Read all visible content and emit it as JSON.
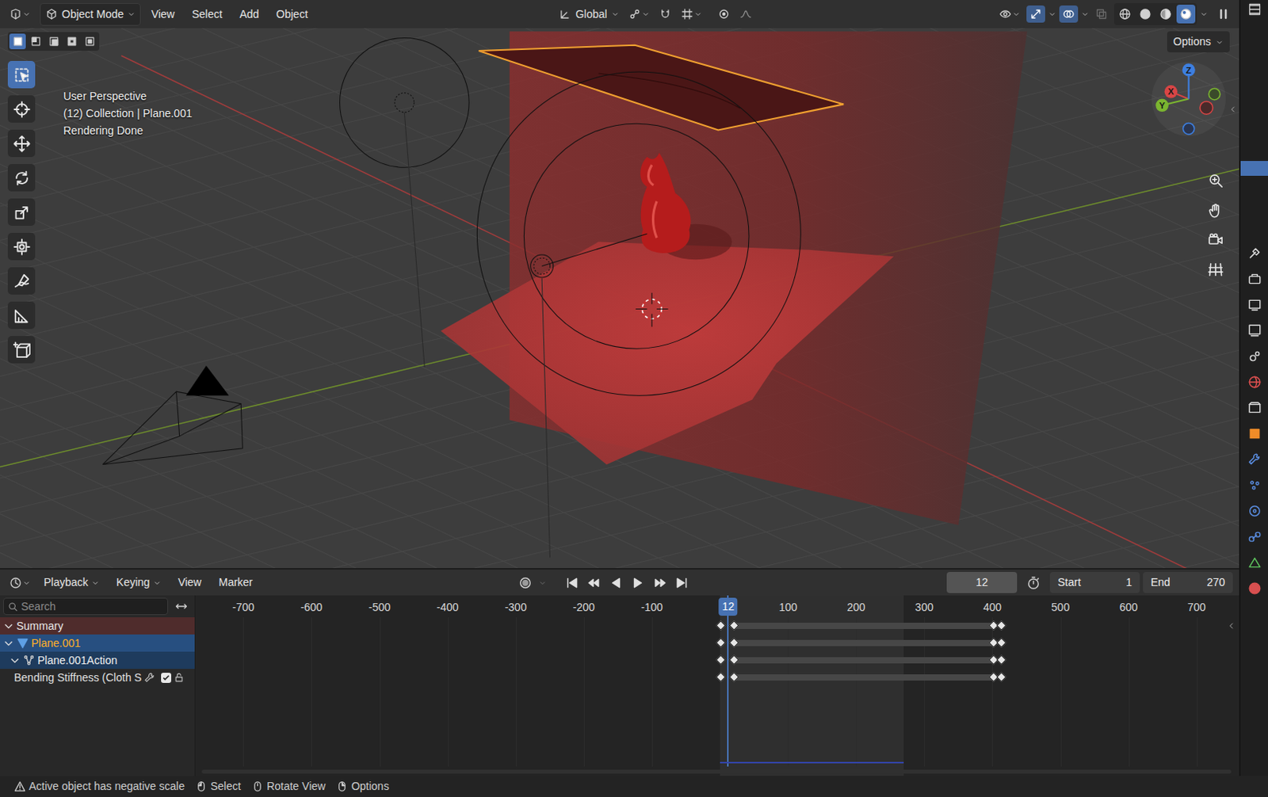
{
  "header": {
    "mode": "Object Mode",
    "menus": [
      "View",
      "Select",
      "Add",
      "Object"
    ],
    "orientation": "Global",
    "shading": [
      {
        "selected": false
      },
      {
        "selected": false
      },
      {
        "selected": false
      },
      {
        "selected": true
      }
    ]
  },
  "viewport": {
    "select_modes": [
      {
        "selected": true
      },
      {
        "selected": false
      },
      {
        "selected": false
      },
      {
        "selected": false
      },
      {
        "selected": false
      }
    ],
    "options": "Options",
    "tools": [
      {
        "selected": true
      },
      {
        "selected": false
      },
      {
        "selected": false
      },
      {
        "selected": false
      },
      {
        "selected": false
      },
      {
        "selected": false
      },
      {
        "selected": false
      },
      {
        "selected": false
      },
      {
        "selected": false
      }
    ],
    "overlay": [
      "User Perspective",
      "(12) Collection | Plane.001",
      "Rendering Done"
    ],
    "gizmo": [
      "X",
      "Y",
      "Z"
    ]
  },
  "outliner": {
    "rows": [
      {
        "selected": true
      }
    ]
  },
  "timeline": {
    "menus": [
      "Playback",
      "Keying",
      "View",
      "Marker"
    ],
    "auto_keying": false,
    "current_frame": "12",
    "start_label": "Start",
    "start": "1",
    "end_label": "End",
    "end": "270",
    "search": {
      "placeholder": "Search"
    },
    "ruler": [
      "-700",
      "-600",
      "-500",
      "-400",
      "-300",
      "-200",
      "-100",
      "100",
      "200",
      "300",
      "400",
      "500",
      "600",
      "700"
    ],
    "playhead_frame": "12",
    "channels": [
      {
        "label": "Summary",
        "kind": "summary",
        "expanded": true,
        "selected": false
      },
      {
        "label": "Plane.001",
        "kind": "object",
        "expanded": true,
        "selected": true
      },
      {
        "label": "Plane.001Action",
        "kind": "action",
        "expanded": true,
        "selected": true
      },
      {
        "label": "Bending Stiffness (Cloth S",
        "kind": "fcurve",
        "checked": true,
        "selected": false
      }
    ],
    "keyframes": [
      1,
      21,
      402,
      413
    ],
    "holds": [
      [
        21,
        402
      ]
    ]
  },
  "status_bar": {
    "warning": "Active object has negative scale",
    "hints": [
      "Select",
      "Rotate View",
      "Options"
    ]
  }
}
